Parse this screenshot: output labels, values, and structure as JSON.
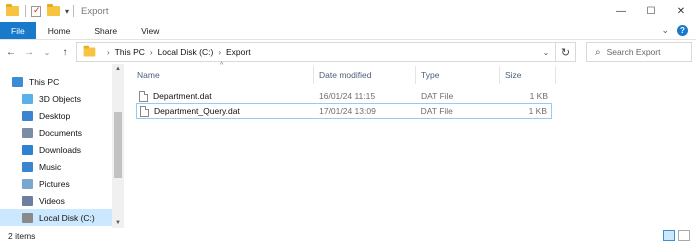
{
  "window": {
    "title": "Export",
    "controls": {
      "minimize": "—",
      "maximize": "☐",
      "close": "✕"
    }
  },
  "ribbon": {
    "tabs": [
      "File",
      "Home",
      "Share",
      "View"
    ],
    "collapse_glyph": "⌄",
    "help_glyph": "?"
  },
  "nav": {
    "back": "←",
    "forward": "→",
    "recent": "⌄",
    "up": "↑"
  },
  "address": {
    "crumbs": [
      "This PC",
      "Local Disk (C:)",
      "Export"
    ],
    "separator": "›",
    "dropdown": "⌄",
    "refresh": "↻"
  },
  "search": {
    "placeholder": "Search Export",
    "icon": "⌕"
  },
  "navpane": {
    "items": [
      {
        "label": "This PC",
        "icon": "computer-icon",
        "color": "#3d8ad6"
      },
      {
        "label": "3D Objects",
        "icon": "cube-icon",
        "color": "#5ab0e8"
      },
      {
        "label": "Desktop",
        "icon": "desktop-icon",
        "color": "#3a84d0"
      },
      {
        "label": "Documents",
        "icon": "documents-icon",
        "color": "#7b8da6"
      },
      {
        "label": "Downloads",
        "icon": "downloads-icon",
        "color": "#2f82d3"
      },
      {
        "label": "Music",
        "icon": "music-icon",
        "color": "#3a84d0"
      },
      {
        "label": "Pictures",
        "icon": "pictures-icon",
        "color": "#7aa6cf"
      },
      {
        "label": "Videos",
        "icon": "videos-icon",
        "color": "#6b7fa0"
      },
      {
        "label": "Local Disk (C:)",
        "icon": "drive-icon",
        "color": "#8a8a8a"
      }
    ],
    "selected_index": 8
  },
  "columns": {
    "name": "Name",
    "date": "Date modified",
    "type": "Type",
    "size": "Size"
  },
  "files": [
    {
      "name": "Department.dat",
      "date": "16/01/24 11:15",
      "type": "DAT File",
      "size": "1 KB"
    },
    {
      "name": "Department_Query.dat",
      "date": "17/01/24 13:09",
      "type": "DAT File",
      "size": "1 KB"
    }
  ],
  "status": {
    "item_count": "2 items"
  },
  "colors": {
    "accent": "#1979ca",
    "selection": "#cce8ff",
    "header_text": "#4c607a"
  }
}
